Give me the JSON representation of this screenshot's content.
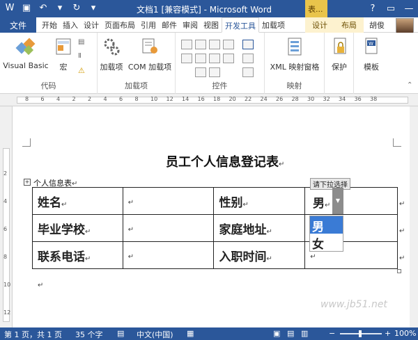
{
  "window": {
    "title": "文档1 [兼容模式] - Microsoft Word",
    "context_title": "表..."
  },
  "tabs": {
    "file": "文件",
    "items": [
      "开始",
      "插入",
      "设计",
      "页面布局",
      "引用",
      "邮件",
      "审阅",
      "视图",
      "开发工具",
      "加载项"
    ],
    "active_index": 8,
    "context_items": [
      "设计",
      "布局"
    ],
    "user": "胡俊"
  },
  "ribbon": {
    "groups": {
      "code": "代码",
      "addins": "加载项",
      "controls": "控件",
      "mapping": "映射",
      "protect": "保护",
      "template": "模板"
    },
    "buttons": {
      "visual_basic": "Visual Basic",
      "macro": "宏",
      "addins": "加载项",
      "com_addins": "COM 加载项",
      "xml_mapping": "XML 映射窗格",
      "protect": "保护",
      "template": "模板"
    }
  },
  "ruler_numbers": [
    "8",
    "6",
    "4",
    "2",
    "2",
    "4",
    "6",
    "8",
    "10",
    "12",
    "14",
    "16",
    "18",
    "20",
    "22",
    "24",
    "26",
    "28",
    "30",
    "32",
    "34",
    "36",
    "38"
  ],
  "vruler_numbers": [
    "2",
    "4",
    "6",
    "8",
    "10",
    "12"
  ],
  "document": {
    "title": "员工个人信息登记表",
    "caption": "个人信息表",
    "rows": [
      [
        "姓名",
        "",
        "性别",
        ""
      ],
      [
        "毕业学校",
        "",
        "家庭地址",
        ""
      ],
      [
        "联系电话",
        "",
        "入职时间",
        ""
      ]
    ],
    "dropdown": {
      "label": "请下拉选择",
      "value": "男",
      "options": [
        "男",
        "女"
      ],
      "selected_index": 0
    },
    "return_mark": "↵"
  },
  "status": {
    "page": "第 1 页，共 1 页",
    "words": "35 个字",
    "language": "中文(中国)",
    "zoom": "100%"
  },
  "watermark": "www.jb51.net",
  "colors": {
    "brand": "#2b579a",
    "context_tab": "#e9c44b",
    "selection": "#3a7bd5"
  }
}
